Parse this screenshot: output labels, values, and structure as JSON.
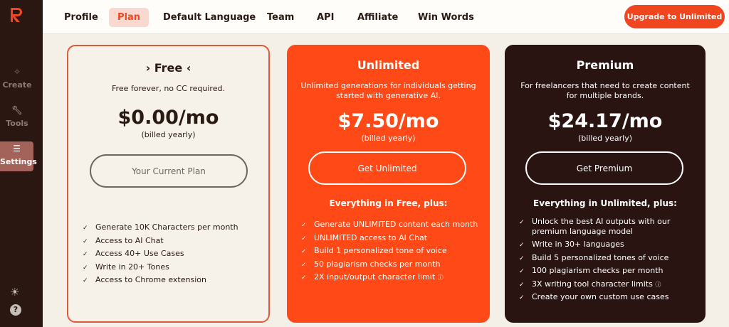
{
  "brand": {
    "logo_letter": "R",
    "accent": "#f0451f"
  },
  "sidebar": {
    "items": [
      {
        "label": "Create",
        "icon": "sparkle-icon"
      },
      {
        "label": "Tools",
        "icon": "wrench-icon"
      },
      {
        "label": "Settings",
        "icon": "sliders-icon"
      }
    ]
  },
  "tabs": [
    "Profile",
    "Plan",
    "Default Language",
    "Team",
    "API",
    "Affiliate",
    "Win Words"
  ],
  "active_tab": "Plan",
  "upgrade_label": "Upgrade to Unlimited",
  "plans": [
    {
      "name": "Free",
      "desc": "Free forever, no CC required.",
      "price": "$0.00/mo",
      "billed": "(billed yearly)",
      "cta": "Your Current Plan",
      "features": [
        "Generate 10K Characters per month",
        "Access to AI Chat",
        "Access 40+ Use Cases",
        "Write in 20+ Tones",
        "Access to Chrome extension"
      ]
    },
    {
      "name": "Unlimited",
      "desc": "Unlimited generations for individuals getting started with generative AI.",
      "price": "$7.50/mo",
      "billed": "(billed yearly)",
      "cta": "Get Unlimited",
      "plus": "Everything in Free, plus:",
      "features": [
        "Generate UNLIMITED content each month",
        "UNLIMITED access to AI Chat",
        "Build 1 personalized tone of voice",
        "50 plagiarism checks per month",
        "2X input/output character limit"
      ]
    },
    {
      "name": "Premium",
      "desc": "For freelancers that need to create content for multiple brands.",
      "price": "$24.17/mo",
      "billed": "(billed yearly)",
      "cta": "Get Premium",
      "plus": "Everything in Unlimited, plus:",
      "features": [
        "Unlock the best AI outputs with our premium language model",
        "Write in 30+ languages",
        "Build 5 personalized tones of voice",
        "100 plagiarism checks per month",
        "3X writing tool character limits",
        "Create your own custom use cases"
      ]
    }
  ]
}
